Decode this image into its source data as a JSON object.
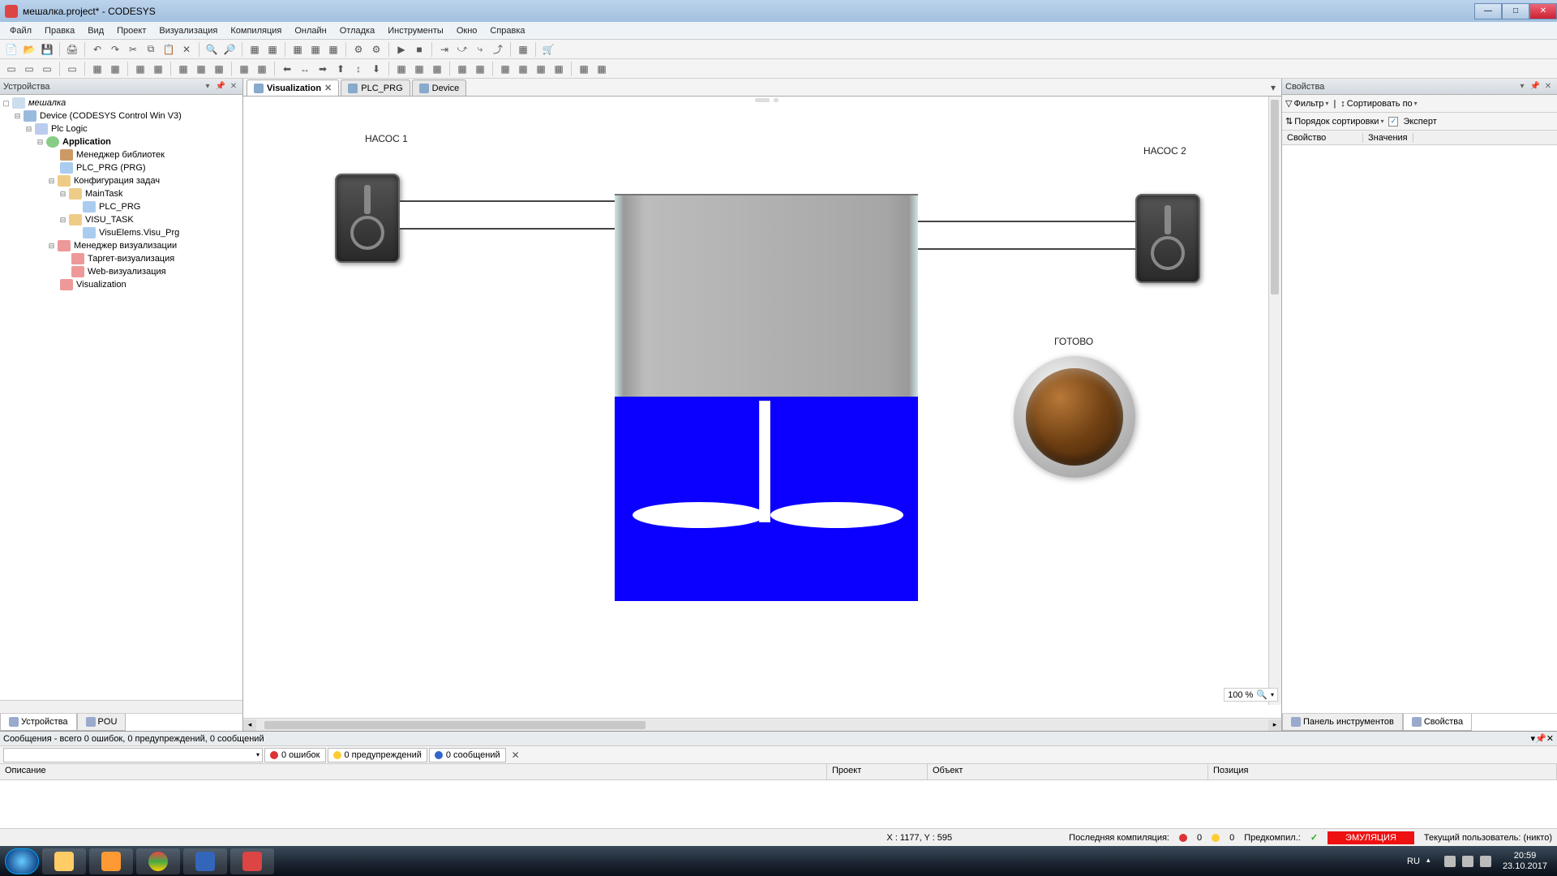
{
  "window": {
    "title": "мешалка.project* - CODESYS"
  },
  "menu": [
    "Файл",
    "Правка",
    "Вид",
    "Проект",
    "Визуализация",
    "Компиляция",
    "Онлайн",
    "Отладка",
    "Инструменты",
    "Окно",
    "Справка"
  ],
  "left": {
    "header": "Устройства",
    "tree": {
      "root": "мешалка",
      "device": "Device (CODESYS Control Win V3)",
      "plc": "Plc Logic",
      "app": "Application",
      "libmgr": "Менеджер библиотек",
      "plcprg": "PLC_PRG (PRG)",
      "taskcfg": "Конфигурация задач",
      "maintask": "MainTask",
      "maintask_prg": "PLC_PRG",
      "visutask": "VISU_TASK",
      "visuelem": "VisuElems.Visu_Prg",
      "vismgr": "Менеджер визуализации",
      "targetvis": "Таргет-визуализация",
      "webvis": "Web-визуализация",
      "visu": "Visualization"
    },
    "bottom_tabs": {
      "devices": "Устройства",
      "pou": "POU"
    }
  },
  "center": {
    "tabs": {
      "visu": "Visualization",
      "plcprg": "PLC_PRG",
      "device": "Device"
    },
    "labels": {
      "pump1": "НАСОС 1",
      "pump2": "НАСОС 2",
      "ready": "ГОТОВО"
    },
    "zoom": "100 %",
    "coords": "X : 1177, Y : 595"
  },
  "right": {
    "header": "Свойства",
    "filter": "Фильтр",
    "sort": "Сортировать по",
    "order": "Порядок сортировки",
    "expert": "Эксперт",
    "cols": {
      "prop": "Свойство",
      "val": "Значения"
    },
    "tabs": {
      "tools": "Панель инструментов",
      "props": "Свойства"
    }
  },
  "messages": {
    "summary": "Сообщения - всего 0 ошибок, 0 предупреждений, 0 сообщений",
    "errors": "0 ошибок",
    "warnings": "0 предупреждений",
    "msgs": "0 сообщений",
    "cols": {
      "desc": "Описание",
      "proj": "Проект",
      "obj": "Объект",
      "pos": "Позиция"
    }
  },
  "status": {
    "compile": "Последняя компиляция:",
    "c_err": "0",
    "c_warn": "0",
    "precomp": "Предкомпил.:",
    "emul": "ЭМУЛЯЦИЯ",
    "user": "Текущий пользователь: (никто)"
  },
  "taskbar": {
    "lang": "RU",
    "time": "20:59",
    "date": "23.10.2017"
  }
}
